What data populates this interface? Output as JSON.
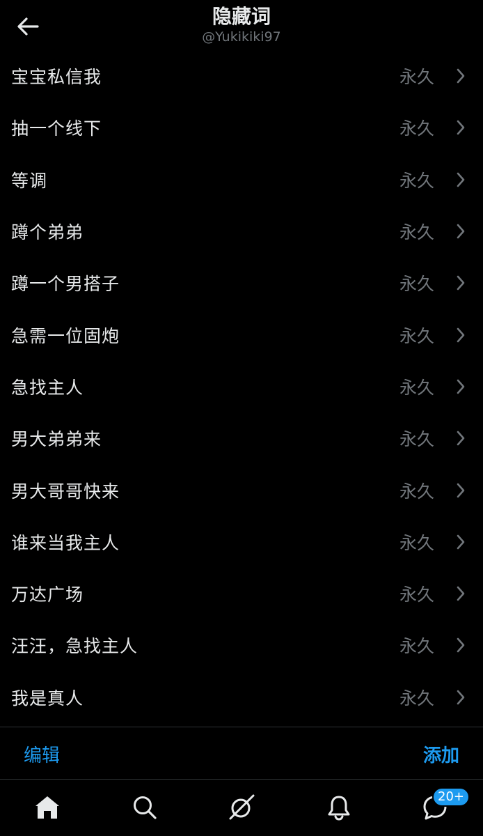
{
  "header": {
    "title": "隐藏词",
    "subtitle": "@Yukikiki97"
  },
  "muted_words": [
    {
      "word": "宝宝私信我",
      "duration": "永久"
    },
    {
      "word": "抽一个线下",
      "duration": "永久"
    },
    {
      "word": "等调",
      "duration": "永久"
    },
    {
      "word": "蹲个弟弟",
      "duration": "永久"
    },
    {
      "word": "蹲一个男搭子",
      "duration": "永久"
    },
    {
      "word": "急需一位固炮",
      "duration": "永久"
    },
    {
      "word": "急找主人",
      "duration": "永久"
    },
    {
      "word": "男大弟弟来",
      "duration": "永久"
    },
    {
      "word": "男大哥哥快来",
      "duration": "永久"
    },
    {
      "word": "谁来当我主人",
      "duration": "永久"
    },
    {
      "word": "万达广场",
      "duration": "永久"
    },
    {
      "word": "汪汪，急找主人",
      "duration": "永久"
    },
    {
      "word": "我是真人",
      "duration": "永久"
    }
  ],
  "actions": {
    "edit_label": "编辑",
    "add_label": "添加"
  },
  "tab_bar": {
    "items": [
      {
        "icon": "home-icon",
        "active": true
      },
      {
        "icon": "search-icon"
      },
      {
        "icon": "grok-icon"
      },
      {
        "icon": "bell-icon"
      },
      {
        "icon": "messages-icon"
      }
    ],
    "messages_badge": "20+"
  },
  "colors": {
    "background": "#000000",
    "text": "#e7e9ea",
    "secondary_text": "#71767b",
    "accent": "#1d9bf0",
    "divider": "#2f3336"
  }
}
